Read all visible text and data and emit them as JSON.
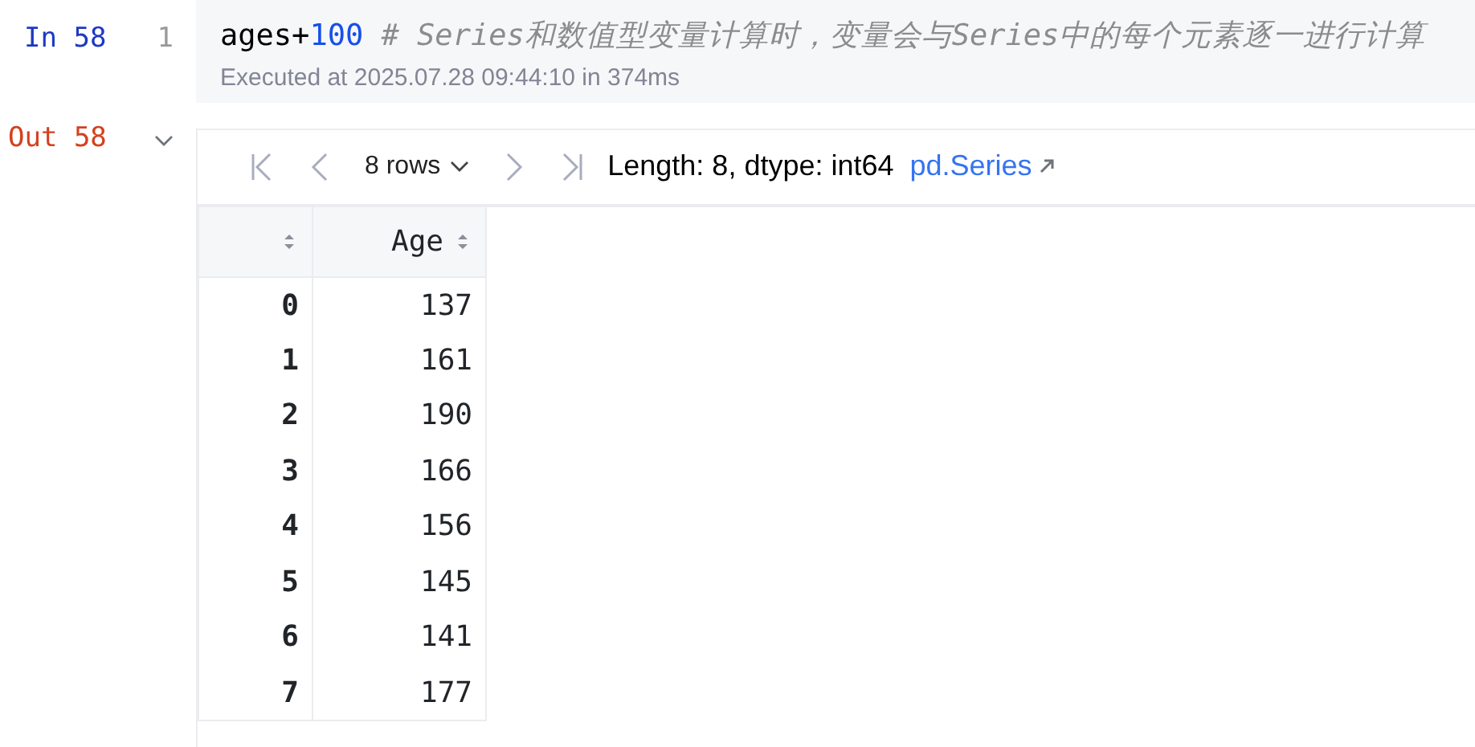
{
  "input_cell": {
    "prompt": "In 58",
    "line_number": "1",
    "code": [
      {
        "kind": "plain",
        "text": "ages+"
      },
      {
        "kind": "number",
        "text": "100"
      },
      {
        "kind": "comment",
        "text": " # Series和数值型变量计算时，变量会与Series中的每个元素逐一进行计算"
      }
    ],
    "status": "Executed at 2025.07.28 09:44:10 in 374ms"
  },
  "output_cell": {
    "prompt": "Out 58",
    "expanded": true,
    "toolbar": {
      "rows_selector": "8 rows",
      "info": "Length: 8, dtype: int64",
      "link": "pd.Series"
    },
    "table": {
      "columns": [
        "",
        "Age"
      ],
      "rows": [
        [
          "0",
          "137"
        ],
        [
          "1",
          "161"
        ],
        [
          "2",
          "190"
        ],
        [
          "3",
          "166"
        ],
        [
          "4",
          "156"
        ],
        [
          "5",
          "145"
        ],
        [
          "6",
          "141"
        ],
        [
          "7",
          "177"
        ]
      ]
    }
  }
}
